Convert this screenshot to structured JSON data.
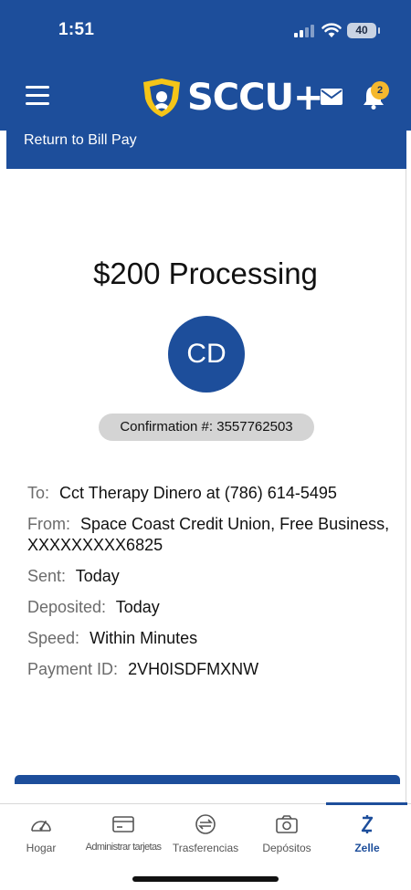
{
  "status_bar": {
    "time": "1:51",
    "battery": "40"
  },
  "header": {
    "brand": "SCCU+",
    "notifications_count": "2"
  },
  "return_link": "Return to Bill Pay",
  "payment": {
    "title": "$200 Processing",
    "initials": "CD",
    "confirmation": "Confirmation #: 3557762503",
    "details": {
      "to_label": "To:",
      "to_value": "Cct Therapy Dinero at (786) 614-5495",
      "from_label": "From:",
      "from_value": "Space Coast Credit Union, Free Business, XXXXXXXXX6825",
      "sent_label": "Sent:",
      "sent_value": "Today",
      "deposited_label": "Deposited:",
      "deposited_value": "Today",
      "speed_label": "Speed:",
      "speed_value": "Within Minutes",
      "payment_id_label": "Payment ID:",
      "payment_id_value": "2VH0ISDFMXNW"
    }
  },
  "bottom_nav": {
    "items": [
      {
        "label": "Hogar",
        "icon": "gauge-icon"
      },
      {
        "label": "Administrar tarjetas",
        "icon": "card-icon"
      },
      {
        "label": "Trasferencias",
        "icon": "transfer-icon"
      },
      {
        "label": "Depósitos",
        "icon": "camera-icon"
      },
      {
        "label": "Zelle",
        "icon": "zelle-icon"
      }
    ],
    "active_index": 4
  },
  "colors": {
    "brand_blue": "#1d4e9b",
    "badge_yellow": "#f5b82e"
  }
}
